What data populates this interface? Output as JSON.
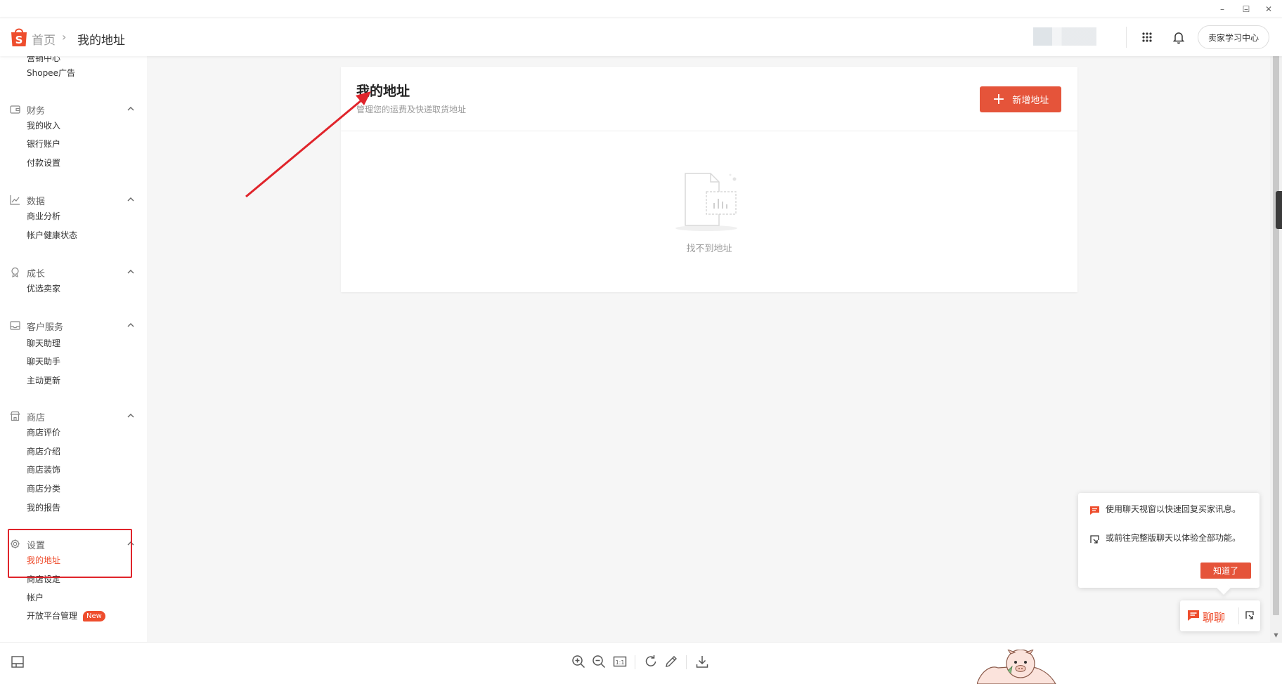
{
  "window": {
    "minimize": "–",
    "maximize": "☐",
    "close": "✕"
  },
  "header": {
    "breadcrumb_home": "首页",
    "breadcrumb_sep": "›",
    "breadcrumb_current": "我的地址",
    "learn_center": "卖家学习中心"
  },
  "sidebar": {
    "clipped_item": "营销中心",
    "top_item": "Shopee广告",
    "groups": [
      {
        "title": "财务",
        "icon": "wallet-icon",
        "items": [
          "我的收入",
          "银行账户",
          "付款设置"
        ]
      },
      {
        "title": "数据",
        "icon": "chart-icon",
        "items": [
          "商业分析",
          "帐户健康状态"
        ]
      },
      {
        "title": "成长",
        "icon": "medal-icon",
        "items": [
          "优选卖家"
        ]
      },
      {
        "title": "客户服务",
        "icon": "inbox-icon",
        "items": [
          "聊天助理",
          "聊天助手",
          "主动更新"
        ]
      },
      {
        "title": "商店",
        "icon": "store-icon",
        "items": [
          "商店评价",
          "商店介绍",
          "商店装饰",
          "商店分类",
          "我的报告"
        ]
      },
      {
        "title": "设置",
        "icon": "gear-icon",
        "items": [
          "我的地址",
          "商店设定",
          "帐户",
          "开放平台管理"
        ]
      }
    ],
    "new_badge": "New"
  },
  "card": {
    "title": "我的地址",
    "subtitle": "管理您的运费及快递取货地址",
    "add_button": "新增地址",
    "empty_text": "找不到地址"
  },
  "chat_tip": {
    "line1": "使用聊天视窗以快速回复买家讯息。",
    "line2": "或前往完整版聊天以体验全部功能。",
    "ok_button": "知道了"
  },
  "chat_button": {
    "label": "聊聊"
  },
  "colors": {
    "accent": "#ee4d2d",
    "button": "#e5543a",
    "annotation": "#e0242b"
  }
}
